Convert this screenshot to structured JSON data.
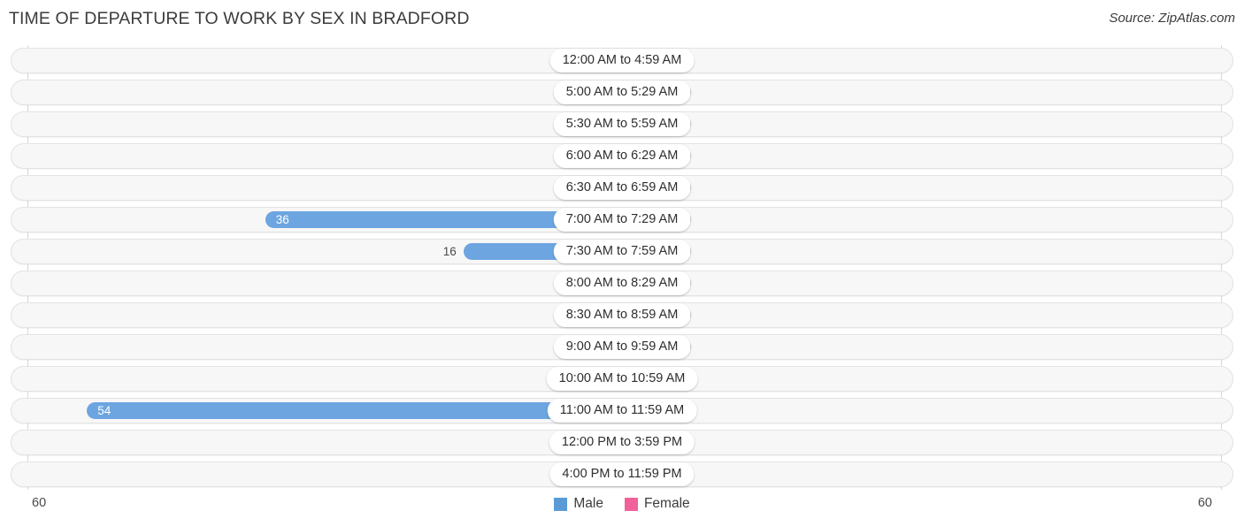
{
  "header": {
    "title": "TIME OF DEPARTURE TO WORK BY SEX IN BRADFORD",
    "source": "Source: ZipAtlas.com"
  },
  "axis": {
    "left_tick": "60",
    "right_tick": "60"
  },
  "legend": {
    "items": [
      {
        "label": "Male",
        "color": "#5b9bd5"
      },
      {
        "label": "Female",
        "color": "#f2629a"
      }
    ]
  },
  "colors": {
    "male_bar": "#6da5e0",
    "male_bar_zero": "#aecdee",
    "female_bar": "#f2629a",
    "female_bar_zero": "#f7aec9",
    "track_fill": "#f7f7f7",
    "track_border": "#e3e3e3",
    "axis_line": "#d8d8d8",
    "title_text": "#3c3c3c"
  },
  "chart_data": {
    "type": "bar",
    "subtype": "diverging-horizontal",
    "title": "TIME OF DEPARTURE TO WORK BY SEX IN BRADFORD",
    "xlabel": "",
    "ylabel": "",
    "xlim": [
      -60,
      60
    ],
    "axis_max": 60,
    "grid": false,
    "legend_position": "bottom-center",
    "categories": [
      "12:00 AM to 4:59 AM",
      "5:00 AM to 5:29 AM",
      "5:30 AM to 5:59 AM",
      "6:00 AM to 6:29 AM",
      "6:30 AM to 6:59 AM",
      "7:00 AM to 7:29 AM",
      "7:30 AM to 7:59 AM",
      "8:00 AM to 8:29 AM",
      "8:30 AM to 8:59 AM",
      "9:00 AM to 9:59 AM",
      "10:00 AM to 10:59 AM",
      "11:00 AM to 11:59 AM",
      "12:00 PM to 3:59 PM",
      "4:00 PM to 11:59 PM"
    ],
    "series": [
      {
        "name": "Male",
        "direction": "left",
        "color": "#6da5e0",
        "values": [
          0,
          0,
          0,
          0,
          0,
          36,
          16,
          0,
          0,
          0,
          0,
          54,
          0,
          0
        ],
        "labels": [
          "0",
          "0",
          "0",
          "0",
          "0",
          "36",
          "16",
          "0",
          "0",
          "0",
          "0",
          "54",
          "0",
          "0"
        ]
      },
      {
        "name": "Female",
        "direction": "right",
        "color": "#f2629a",
        "values": [
          0,
          0,
          0,
          0,
          0,
          0,
          0,
          0,
          0,
          0,
          0,
          0,
          0,
          0
        ],
        "labels": [
          "0",
          "0",
          "0",
          "0",
          "0",
          "0",
          "0",
          "0",
          "0",
          "0",
          "0",
          "0",
          "0",
          "0"
        ]
      }
    ]
  }
}
